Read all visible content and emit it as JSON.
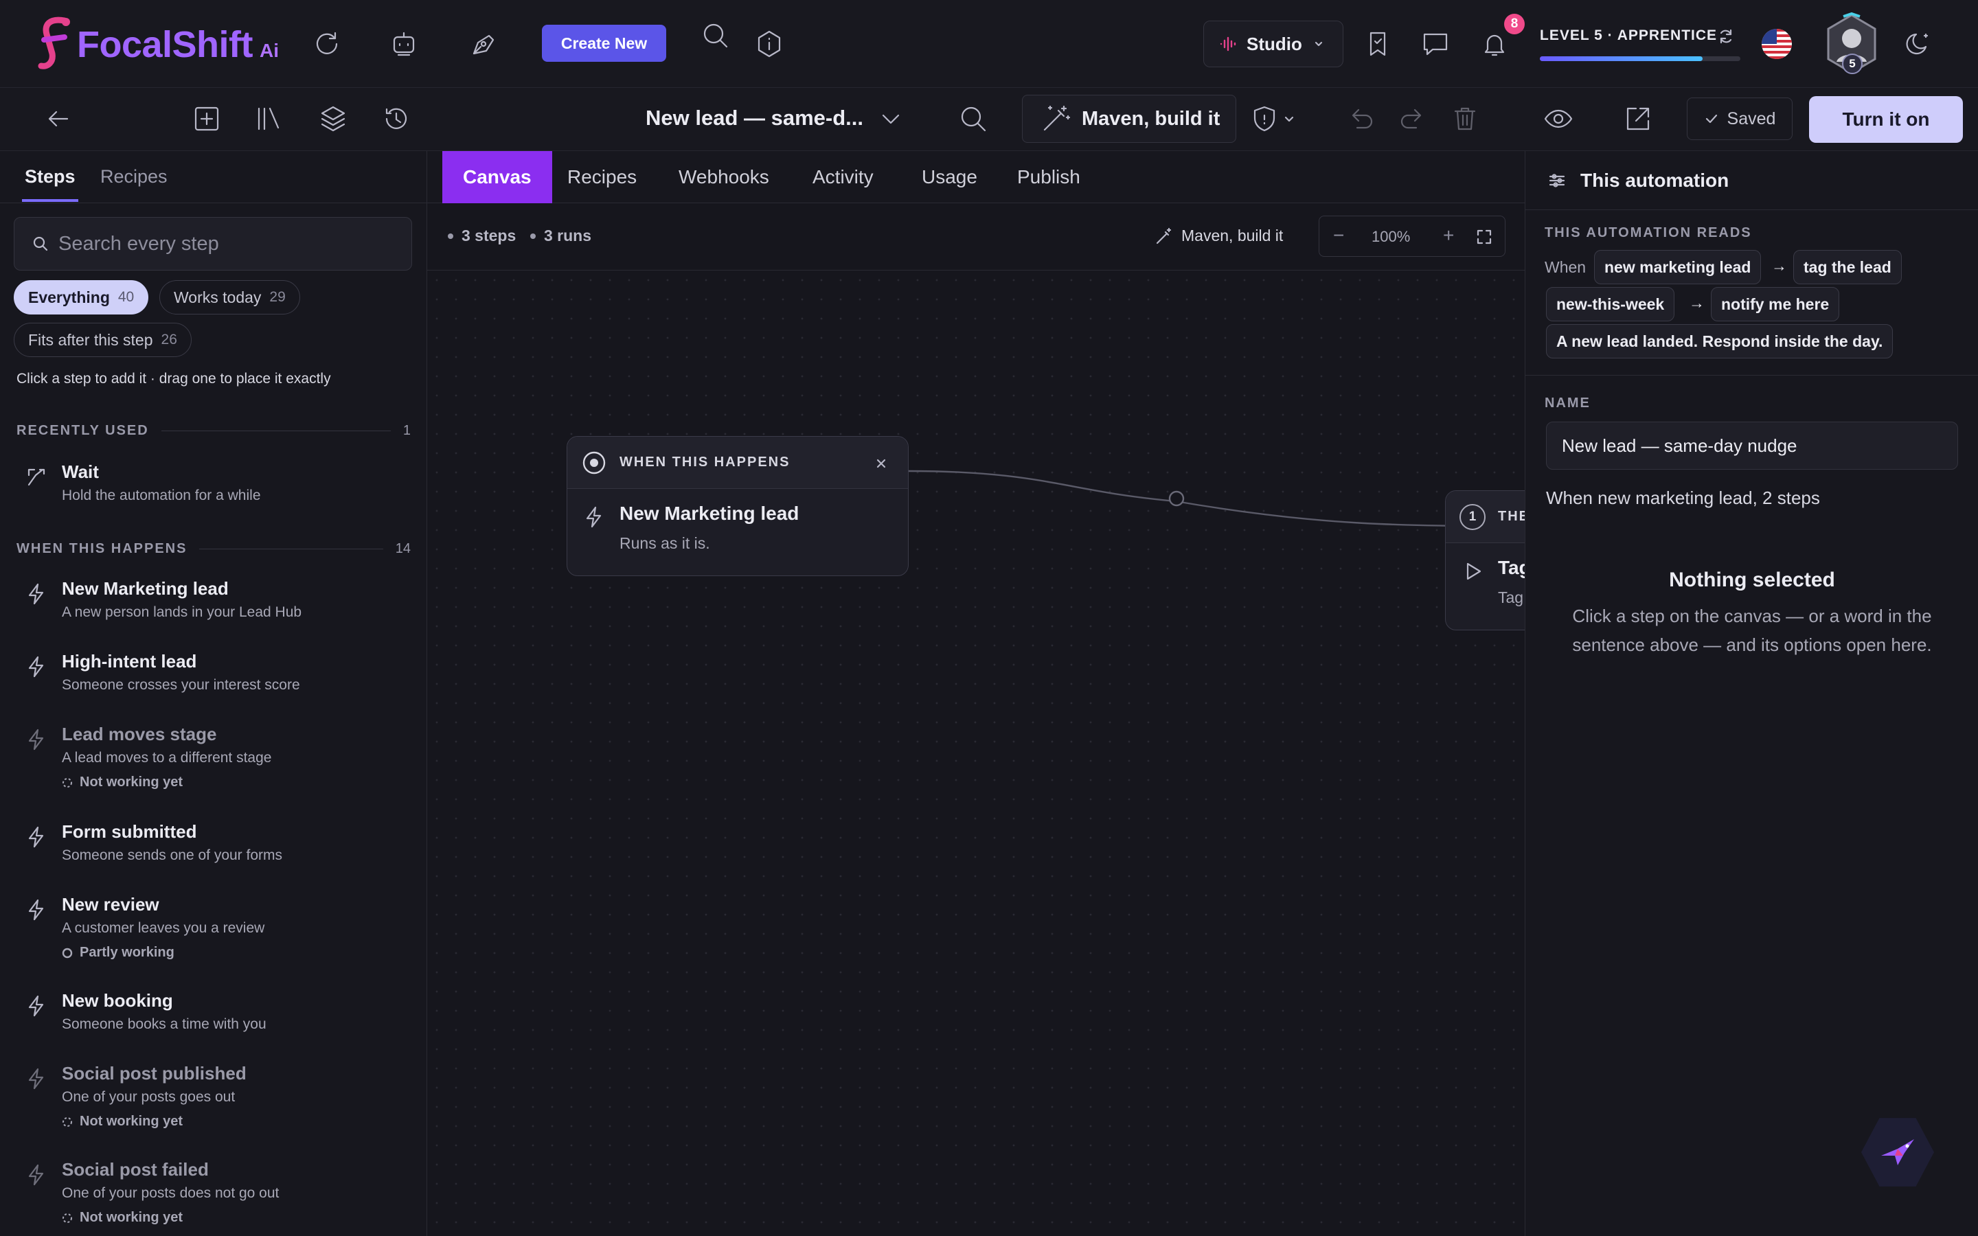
{
  "brand": {
    "name": "FocalShift",
    "suffix": "Ai"
  },
  "header": {
    "create_label": "Create New",
    "studio_label": "Studio",
    "notification_count": "8",
    "level_text": "LEVEL 5 · APPRENTICE",
    "level_progress": 0.81,
    "avatar_level": "5"
  },
  "subheader": {
    "title": "New lead — same-d...",
    "maven_label": "Maven, build it",
    "saved_label": "Saved",
    "turn_on_label": "Turn it on"
  },
  "left_panel": {
    "tabs": [
      "Steps",
      "Recipes"
    ],
    "search_placeholder": "Search every step",
    "filters": [
      {
        "label": "Everything",
        "count": "40"
      },
      {
        "label": "Works today",
        "count": "29"
      },
      {
        "label": "Fits after this step",
        "count": "26"
      }
    ],
    "hint": "Click a step to add it · drag one to place it exactly",
    "recent": {
      "title": "RECENTLY USED",
      "count": "1",
      "items": [
        {
          "name": "Wait",
          "desc": "Hold the automation for a while"
        }
      ]
    },
    "when": {
      "title": "WHEN THIS HAPPENS",
      "count": "14",
      "items": [
        {
          "name": "New Marketing lead",
          "desc": "A new person lands in your Lead Hub",
          "status": ""
        },
        {
          "name": "High-intent lead",
          "desc": "Someone crosses your interest score",
          "status": ""
        },
        {
          "name": "Lead moves stage",
          "desc": "A lead moves to a different stage",
          "status": "Not working yet"
        },
        {
          "name": "Form submitted",
          "desc": "Someone sends one of your forms",
          "status": ""
        },
        {
          "name": "New review",
          "desc": "A customer leaves you a review",
          "status": "Partly working"
        },
        {
          "name": "New booking",
          "desc": "Someone books a time with you",
          "status": ""
        },
        {
          "name": "Social post published",
          "desc": "One of your posts goes out",
          "status": "Not working yet"
        },
        {
          "name": "Social post failed",
          "desc": "One of your posts does not go out",
          "status": "Not working yet"
        }
      ]
    }
  },
  "canvas": {
    "tabs": [
      "Canvas",
      "Recipes",
      "Webhooks",
      "Activity",
      "Usage",
      "Publish"
    ],
    "steps_count": "3 steps",
    "runs_count": "3 runs",
    "maven_label": "Maven, build it",
    "zoom": "100%",
    "trigger_node": {
      "label": "WHEN THIS HAPPENS",
      "title": "New Marketing lead",
      "subtitle": "Runs as it is."
    },
    "then_node": {
      "index": "1",
      "label": "THE",
      "title": "Tag",
      "subtitle": "Tag"
    }
  },
  "right_panel": {
    "title": "This automation",
    "reads_label": "THIS AUTOMATION READS",
    "when_word": "When",
    "arrow": "→",
    "pills": [
      "new marketing lead",
      "tag the lead",
      "new-this-week",
      "notify me here",
      "A new lead landed. Respond inside the day."
    ],
    "name_label": "NAME",
    "name_value": "New lead — same-day nudge",
    "summary": "When new marketing lead, 2 steps",
    "empty_title": "Nothing selected",
    "empty_desc": "Click a step on the canvas — or a word in the sentence above — and its options open here."
  },
  "colors": {
    "accent": "#8b2ef0",
    "primary_button": "#5b55e8",
    "turn_on": "#cfcdfb",
    "badge": "#f04a8a"
  },
  "icons": [
    "refresh-icon",
    "bot-icon",
    "pen-icon",
    "search-icon",
    "info-icon",
    "bookmark-icon",
    "chat-icon",
    "bell-icon",
    "sync-icon",
    "moon-icon",
    "back-icon",
    "add-icon",
    "library-icon",
    "layers-icon",
    "history-icon",
    "chevron-down-icon",
    "wand-icon",
    "shield-icon",
    "undo-icon",
    "redo-icon",
    "trash-icon",
    "eye-icon",
    "external-link-icon",
    "check-icon",
    "bolt-icon",
    "split-icon",
    "settings-icon",
    "bird-icon"
  ]
}
